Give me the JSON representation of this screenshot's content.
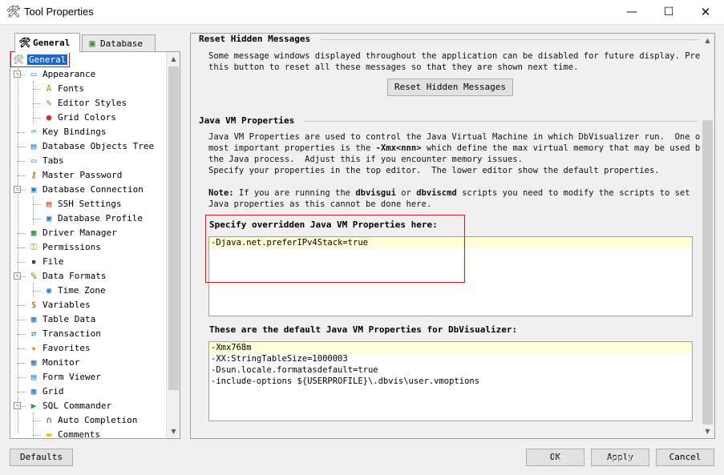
{
  "window": {
    "title": "Tool Properties",
    "controls": {
      "minimize": "—",
      "maximize": "☐",
      "close": "✕"
    }
  },
  "left_tabs": [
    {
      "label": "General",
      "icon": "tools-icon",
      "active": true
    },
    {
      "label": "Database",
      "icon": "database-icon",
      "active": false
    }
  ],
  "tree": [
    {
      "label": "General",
      "icon": "tools-icon",
      "level": 0,
      "selected": true
    },
    {
      "label": "Appearance",
      "icon": "monitor-icon",
      "level": 1,
      "expander": "-"
    },
    {
      "label": "Fonts",
      "icon": "font-icon",
      "level": 2
    },
    {
      "label": "Editor Styles",
      "icon": "editor-styles-icon",
      "level": 2
    },
    {
      "label": "Grid Colors",
      "icon": "palette-icon",
      "level": 2
    },
    {
      "label": "Key Bindings",
      "icon": "keyboard-icon",
      "level": 1
    },
    {
      "label": "Database Objects Tree",
      "icon": "tree-icon",
      "level": 1
    },
    {
      "label": "Tabs",
      "icon": "tabs-icon",
      "level": 1
    },
    {
      "label": "Master Password",
      "icon": "key-icon",
      "level": 1
    },
    {
      "label": "Database Connection",
      "icon": "db-connection-icon",
      "level": 1,
      "expander": "-"
    },
    {
      "label": "SSH Settings",
      "icon": "ssh-icon",
      "level": 2
    },
    {
      "label": "Database Profile",
      "icon": "db-profile-icon",
      "level": 2
    },
    {
      "label": "Driver Manager",
      "icon": "driver-icon",
      "level": 1
    },
    {
      "label": "Permissions",
      "icon": "permissions-icon",
      "level": 1
    },
    {
      "label": "File",
      "icon": "file-icon",
      "level": 1
    },
    {
      "label": "Data Formats",
      "icon": "percent-icon",
      "level": 1,
      "expander": "-"
    },
    {
      "label": "Time Zone",
      "icon": "globe-icon",
      "level": 2
    },
    {
      "label": "Variables",
      "icon": "dollar-icon",
      "level": 1
    },
    {
      "label": "Table Data",
      "icon": "table-icon",
      "level": 1
    },
    {
      "label": "Transaction",
      "icon": "transaction-icon",
      "level": 1
    },
    {
      "label": "Favorites",
      "icon": "star-icon",
      "level": 1
    },
    {
      "label": "Monitor",
      "icon": "monitor-grid-icon",
      "level": 1
    },
    {
      "label": "Form Viewer",
      "icon": "form-icon",
      "level": 1
    },
    {
      "label": "Grid",
      "icon": "grid-icon",
      "level": 1
    },
    {
      "label": "SQL Commander",
      "icon": "play-icon",
      "level": 1,
      "expander": "-"
    },
    {
      "label": "Auto Completion",
      "icon": "autocomplete-icon",
      "level": 2
    },
    {
      "label": "Comments",
      "icon": "folder-icon",
      "level": 2
    }
  ],
  "reset_section": {
    "title": "Reset Hidden Messages",
    "text": "Some message windows displayed throughout the application can be disabled for future display. Press\nthis button to reset all these messages so that they are shown next time.",
    "button": "Reset Hidden Messages"
  },
  "jvm_section": {
    "title": "Java VM Properties",
    "text_line1": "Java VM Properties are used to control the Java Virtual Machine in which DbVisualizer run.  One of",
    "text_line2_a": "most important properties is the ",
    "text_line2_b": "-Xmx<nnn>",
    "text_line2_c": " which define the max virtual memory that may be used by",
    "text_line3": "the Java process.  Adjust this if you encounter memory issues.",
    "text_line4": "Specify your properties in the top editor.  The lower editor show the default properties.",
    "note_label": "Note:",
    "note_a": " If you are running the ",
    "note_b": "dbvisgui",
    "note_c": " or ",
    "note_d": "dbviscmd",
    "note_e": " scripts you need to modify the scripts to set",
    "note_line2": "Java properties as this cannot be done here.",
    "override_label": "Specify overridden Java VM Properties here:",
    "override_lines": [
      "-Djava.net.preferIPv4Stack=true"
    ],
    "defaults_label": "These are the default Java VM Properties for DbVisualizer:",
    "default_lines": [
      "-Xmx768m",
      "-XX:StringTableSize=1000003",
      "-Dsun.locale.formatasdefault=true",
      "-include-options ${USERPROFILE}\\.dbvis\\user.vmoptions"
    ]
  },
  "footer": {
    "defaults": "Defaults",
    "ok": "OK",
    "apply": "Apply",
    "cancel": "Cancel",
    "watermark": "https://blog.csdn.net/.../..."
  },
  "colors": {
    "selection": "#1f64c8",
    "highlight_box": "#e4141c",
    "editor_current_line": "#ffffd8"
  }
}
